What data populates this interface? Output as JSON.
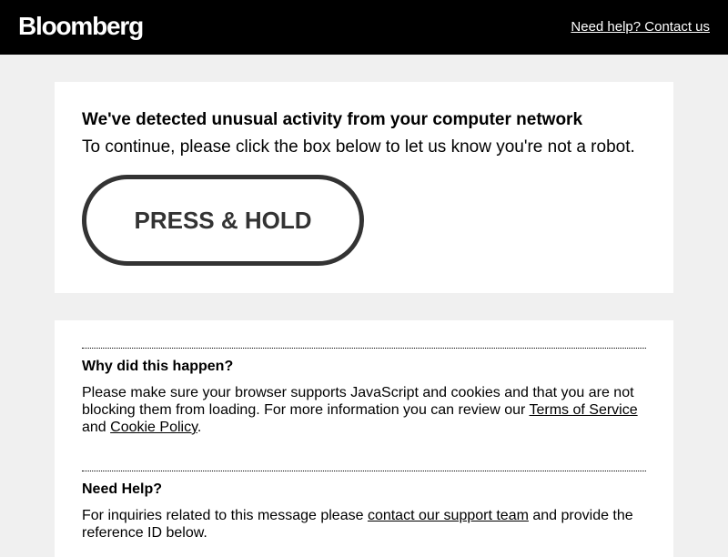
{
  "header": {
    "logo": "Bloomberg",
    "help_link": "Need help? Contact us",
    "background": "#000000"
  },
  "challenge": {
    "title": "We've detected unusual activity from your computer network",
    "subtitle": "To continue, please click the box below to let us know you're not a robot.",
    "button_label": "PRESS & HOLD"
  },
  "info": {
    "why": {
      "heading": "Why did this happen?",
      "text_before": "Please make sure your browser supports JavaScript and cookies and that you are not blocking them from loading. For more information you can review our ",
      "terms_link": "Terms of Service",
      "text_middle": " and ",
      "cookie_link": "Cookie Policy",
      "text_after": "."
    },
    "help": {
      "heading": "Need Help?",
      "text_before": "For inquiries related to this message please ",
      "support_link": "contact our support team",
      "text_after": " and provide the reference ID below."
    }
  },
  "colors": {
    "page_bg": "#f0f0f0",
    "card_bg": "#ffffff",
    "button_border": "#333333"
  }
}
